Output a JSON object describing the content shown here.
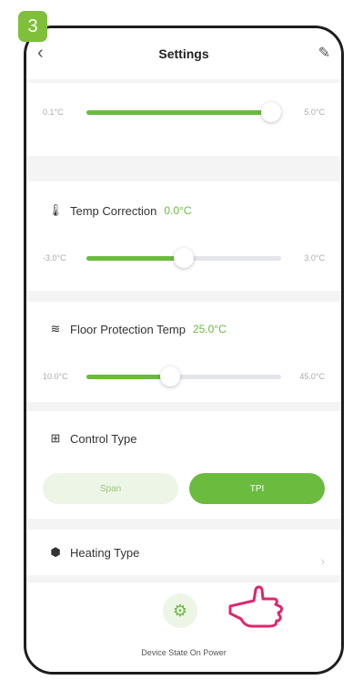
{
  "step": "3",
  "header": {
    "title": "Settings"
  },
  "top_slider": {
    "min": "0.1°C",
    "max": "5.0°C",
    "value": 0.95
  },
  "temp_correction": {
    "label": "Temp Correction",
    "value": "0.0°C",
    "min": "-3.0°C",
    "max": "3.0°C",
    "level": 0.5
  },
  "floor_protection": {
    "label": "Floor Protection Temp",
    "value": "25.0°C",
    "min": "10.0°C",
    "max": "45.0°C",
    "level": 0.43
  },
  "control_type": {
    "label": "Control Type",
    "options": [
      "Span",
      "TPI"
    ],
    "selected": "TPI"
  },
  "heating_type": {
    "label": "Heating Type"
  },
  "device_state": {
    "label": "Device State On Power"
  },
  "colors": {
    "accent": "#6abb3e",
    "badge": "#7fbf3a"
  }
}
